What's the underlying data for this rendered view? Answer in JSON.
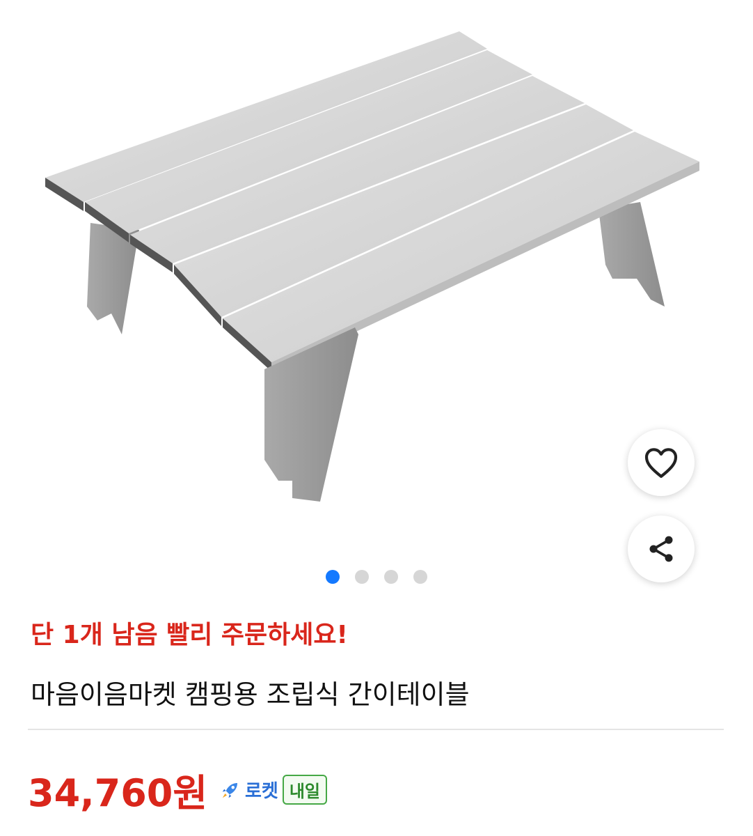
{
  "product": {
    "image_alt": "캠핑용 조립식 간이테이블",
    "stock_alert": "단 1개 남음 빨리 주문하세요!",
    "title": "마음이음마켓 캠핑용 조립식 간이테이블",
    "price": "34,760원",
    "rocket_label": "로켓",
    "delivery_badge": "내일"
  },
  "carousel": {
    "total": 4,
    "active": 1
  },
  "icons": {
    "favorite": "heart-icon",
    "share": "share-icon",
    "rocket": "rocket-icon"
  },
  "colors": {
    "accent_red": "#d9261b",
    "dot_active": "#1479ff",
    "rocket_blue": "#2a6fd6",
    "badge_green": "#2c8a2c"
  }
}
